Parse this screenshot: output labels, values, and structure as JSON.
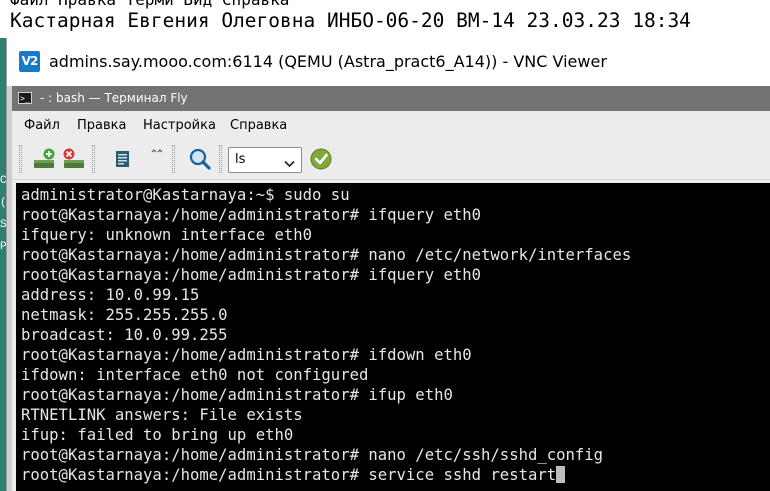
{
  "caption": {
    "text": "Кастарная Евгения Олеговна ИНБО-06-20 ВМ-14 23.03.23 18:34",
    "ghost_text": "Файл Правка Терми Вид Справка"
  },
  "left_sliver": {
    "chars": [
      "C",
      "(",
      "",
      "",
      "S",
      "",
      "",
      "P"
    ]
  },
  "vnc": {
    "logo_text": "V2",
    "title": "admins.say.mooo.com:6114 (QEMU (Astra_pract6_A14)) - VNC Viewer"
  },
  "fly": {
    "title": "- : bash — Терминал Fly",
    "title_icon": ">_",
    "menu": [
      "Файл",
      "Правка",
      "Настройка",
      "Справка"
    ],
    "toolbar": {
      "new_tab_icon": "add-tab-icon",
      "close_tab_icon": "close-tab-icon",
      "copy_icon": "document-icon",
      "paste_icon": "paste-icon",
      "search_icon": "magnifier-icon",
      "command_select_value": "ls",
      "run_icon": "checkmark-icon"
    }
  },
  "terminal": {
    "lines": [
      "administrator@Kastarnaya:~$ sudo su",
      "root@Kastarnaya:/home/administrator# ifquery eth0",
      "ifquery: unknown interface eth0",
      "root@Kastarnaya:/home/administrator# nano /etc/network/interfaces",
      "root@Kastarnaya:/home/administrator# ifquery eth0",
      "address: 10.0.99.15",
      "netmask: 255.255.255.0",
      "broadcast: 10.0.99.255",
      "root@Kastarnaya:/home/administrator# ifdown eth0",
      "ifdown: interface eth0 not configured",
      "root@Kastarnaya:/home/administrator# ifup eth0",
      "RTNETLINK answers: File exists",
      "ifup: failed to bring up eth0",
      "root@Kastarnaya:/home/administrator# nano /etc/ssh/sshd_config",
      "root@Kastarnaya:/home/administrator# service sshd restart"
    ],
    "colors": {
      "background": "#000000",
      "foreground": "#e6e6e6"
    }
  }
}
